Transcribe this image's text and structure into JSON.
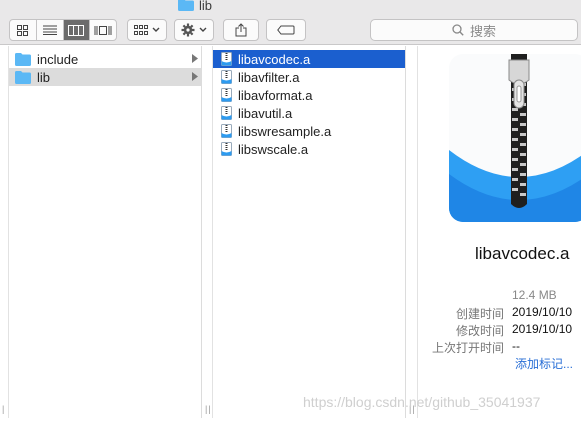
{
  "window": {
    "title": "lib"
  },
  "toolbar": {
    "view_modes": [
      "icon-view-icon",
      "list-view-icon",
      "column-view-icon",
      "gallery-view-icon"
    ],
    "active_view": 2,
    "search": {
      "placeholder": "搜索"
    }
  },
  "columns": {
    "first": [
      {
        "label": "include",
        "selected": false
      },
      {
        "label": "lib",
        "selected": true
      }
    ],
    "second": [
      {
        "label": "libavcodec.a",
        "selected": true
      },
      {
        "label": "libavfilter.a",
        "selected": false
      },
      {
        "label": "libavformat.a",
        "selected": false
      },
      {
        "label": "libavutil.a",
        "selected": false
      },
      {
        "label": "libswresample.a",
        "selected": false
      },
      {
        "label": "libswscale.a",
        "selected": false
      }
    ]
  },
  "preview": {
    "name": "libavcodec.a",
    "size": "12.4 MB",
    "created_label": "创建时间",
    "created_value": "2019/10/10",
    "modified_label": "修改时间",
    "modified_value": "2019/10/10",
    "last_opened_label": "上次打开时间",
    "last_opened_value": "--",
    "add_tags": "添加标记..."
  },
  "watermark": "https://blog.csdn.net/github_35041937",
  "colors": {
    "selection": "#1b5fcf",
    "folder": "#5bb8f5",
    "link": "#2a6fd6"
  }
}
